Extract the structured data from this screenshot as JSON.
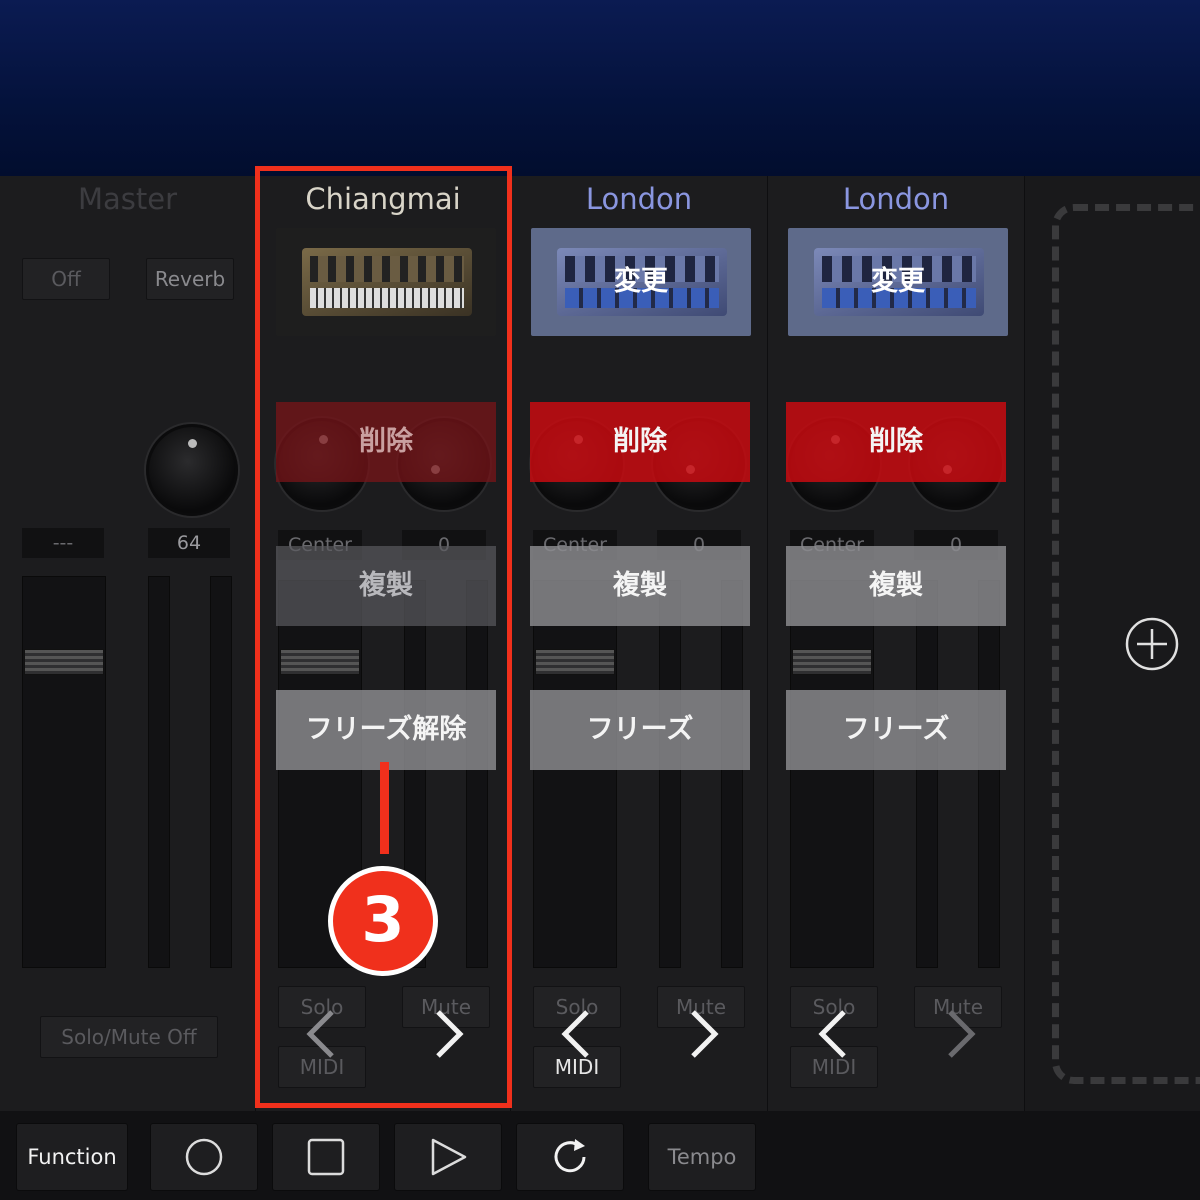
{
  "master": {
    "name": "Master",
    "off_label": "Off",
    "reverb_label": "Reverb",
    "left_value": "---",
    "right_value": "64",
    "solo_mute_off_label": "Solo/Mute Off"
  },
  "strips": [
    {
      "name": "Chiangmai",
      "name_color": "#d8d4c8",
      "delete_label": "削除",
      "duplicate_label": "複製",
      "freeze_label": "フリーズ解除",
      "pan_label": "Center",
      "pan_value": "0",
      "solo_label": "Solo",
      "mute_label": "Mute",
      "midi_label": "MIDI"
    },
    {
      "name": "London",
      "name_color": "#8a96e0",
      "change_label": "変更",
      "delete_label": "削除",
      "duplicate_label": "複製",
      "freeze_label": "フリーズ",
      "pan_label": "Center",
      "pan_value": "0",
      "solo_label": "Solo",
      "mute_label": "Mute",
      "midi_label": "MIDI"
    },
    {
      "name": "London",
      "name_color": "#8a96e0",
      "change_label": "変更",
      "delete_label": "削除",
      "duplicate_label": "複製",
      "freeze_label": "フリーズ",
      "pan_label": "Center",
      "pan_value": "0",
      "solo_label": "Solo",
      "mute_label": "Mute",
      "midi_label": "MIDI"
    }
  ],
  "annotation": {
    "number": "3",
    "color": "#f0301c"
  },
  "toolbar": {
    "function_label": "Function",
    "record_icon": "record-icon",
    "stop_icon": "stop-icon",
    "play_icon": "play-icon",
    "loop_icon": "loop-icon",
    "tempo_label": "Tempo"
  }
}
